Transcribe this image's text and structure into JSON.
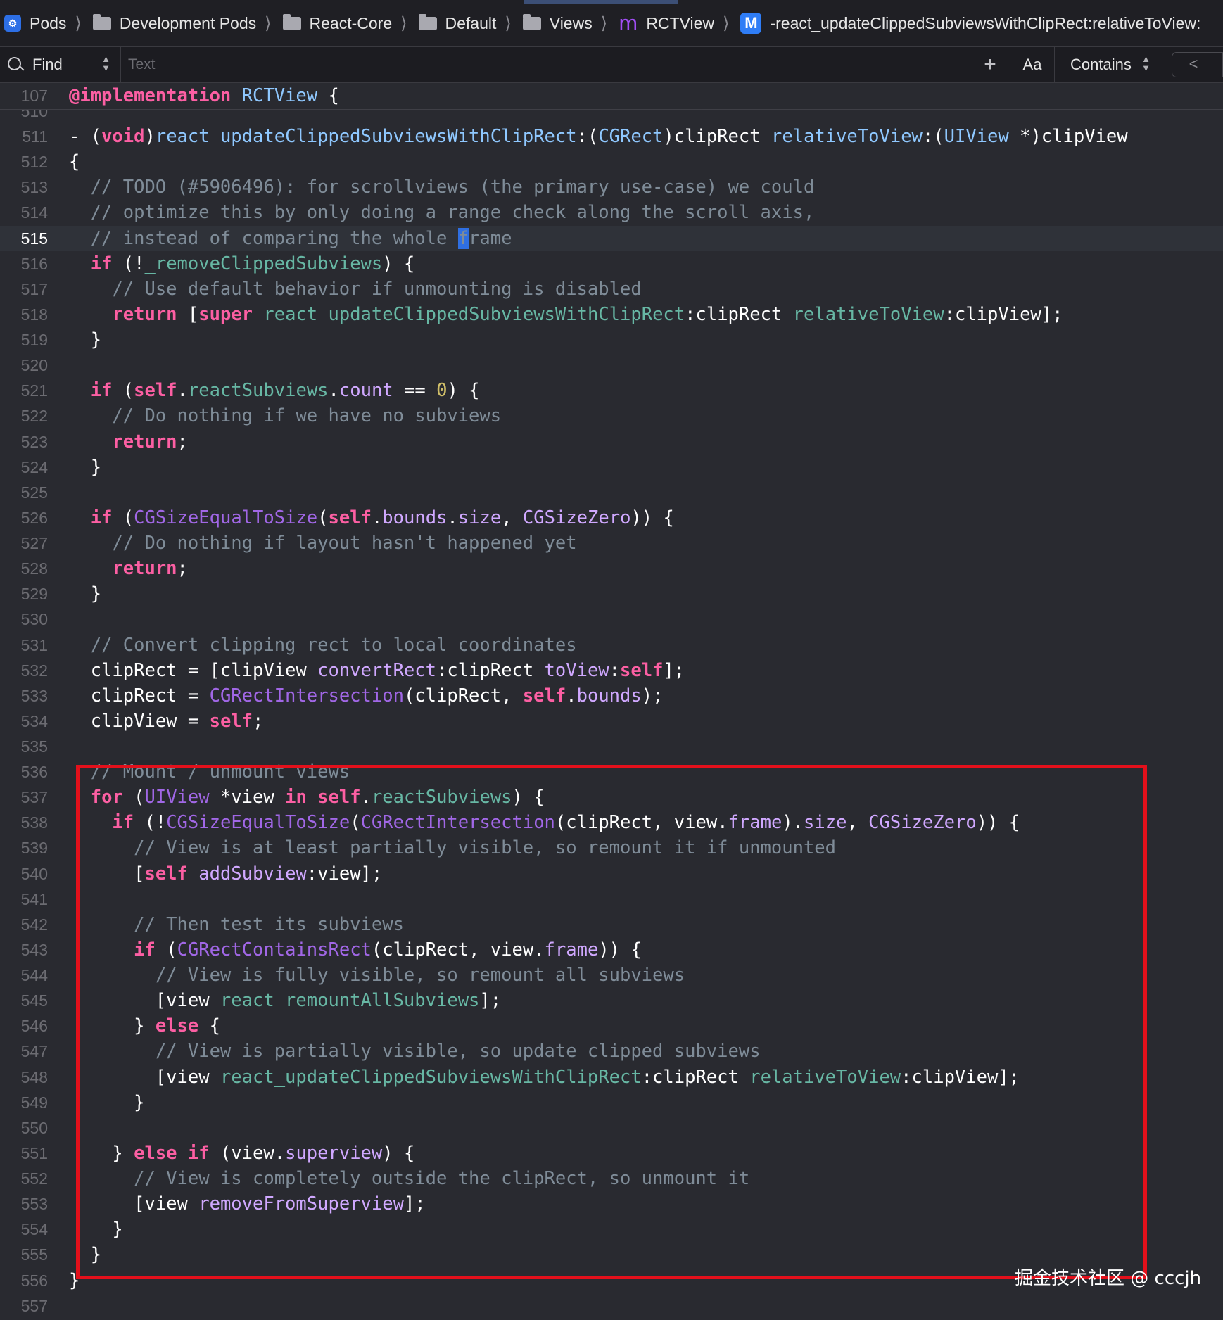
{
  "breadcrumb": {
    "items": [
      {
        "label": "Pods",
        "icon": "app-icon"
      },
      {
        "label": "Development Pods",
        "icon": "folder-icon"
      },
      {
        "label": "React-Core",
        "icon": "folder-icon"
      },
      {
        "label": "Default",
        "icon": "folder-icon"
      },
      {
        "label": "Views",
        "icon": "folder-icon"
      },
      {
        "label": "RCTView",
        "icon": "implementation-icon"
      },
      {
        "label": "-react_updateClippedSubviewsWithClipRect:relativeToView:",
        "icon": "method-icon"
      }
    ],
    "implementation_glyph": "m",
    "method_glyph": "M"
  },
  "findbar": {
    "mode": "Find",
    "placeholder": "Text",
    "add_label": "+",
    "case_label": "Aa",
    "match_mode": "Contains",
    "prev_label": "<"
  },
  "editor": {
    "current_line": "515",
    "sticky_header": {
      "number": "107",
      "tokens": [
        {
          "t": "@implementation",
          "c": "kw"
        },
        {
          "t": " "
        },
        {
          "t": "RCTView",
          "c": "ty"
        },
        {
          "t": " {"
        }
      ]
    },
    "lines": [
      {
        "n": "510",
        "tokens": []
      },
      {
        "n": "511",
        "tokens": [
          {
            "t": "- ("
          },
          {
            "t": "void",
            "c": "kw"
          },
          {
            "t": ")"
          },
          {
            "t": "react_updateClippedSubviewsWithClipRect",
            "c": "ty"
          },
          {
            "t": ":("
          },
          {
            "t": "CGRect",
            "c": "ty"
          },
          {
            "t": ")clipRect "
          },
          {
            "t": "relativeToView",
            "c": "ty"
          },
          {
            "t": ":("
          },
          {
            "t": "UIView",
            "c": "ty"
          },
          {
            "t": " *)clipView"
          }
        ]
      },
      {
        "n": "512",
        "tokens": [
          {
            "t": "{"
          }
        ]
      },
      {
        "n": "513",
        "tokens": [
          {
            "t": "  // TODO (#5906496): for scrollviews (the primary use-case) we could",
            "c": "cm"
          }
        ]
      },
      {
        "n": "514",
        "tokens": [
          {
            "t": "  // optimize this by only doing a range check along the scroll axis,",
            "c": "cm"
          }
        ]
      },
      {
        "n": "515",
        "tokens": [
          {
            "t": "  // instead of comparing the whole ",
            "c": "cm"
          },
          {
            "t": "f",
            "c": "cursor"
          },
          {
            "t": "rame",
            "c": "cm"
          }
        ]
      },
      {
        "n": "516",
        "tokens": [
          {
            "t": "  "
          },
          {
            "t": "if",
            "c": "kw"
          },
          {
            "t": " (!"
          },
          {
            "t": "_removeClippedSubviews",
            "c": "fn"
          },
          {
            "t": ") {"
          }
        ]
      },
      {
        "n": "517",
        "tokens": [
          {
            "t": "    // Use default behavior if unmounting is disabled",
            "c": "cm"
          }
        ]
      },
      {
        "n": "518",
        "tokens": [
          {
            "t": "    "
          },
          {
            "t": "return",
            "c": "kw"
          },
          {
            "t": " ["
          },
          {
            "t": "super",
            "c": "kw"
          },
          {
            "t": " "
          },
          {
            "t": "react_updateClippedSubviewsWithClipRect",
            "c": "fn"
          },
          {
            "t": ":clipRect "
          },
          {
            "t": "relativeToView",
            "c": "fn"
          },
          {
            "t": ":clipView];"
          }
        ]
      },
      {
        "n": "519",
        "tokens": [
          {
            "t": "  }"
          }
        ]
      },
      {
        "n": "520",
        "tokens": []
      },
      {
        "n": "521",
        "tokens": [
          {
            "t": "  "
          },
          {
            "t": "if",
            "c": "kw"
          },
          {
            "t": " ("
          },
          {
            "t": "self",
            "c": "kw"
          },
          {
            "t": "."
          },
          {
            "t": "reactSubviews",
            "c": "fn"
          },
          {
            "t": "."
          },
          {
            "t": "count",
            "c": "fc"
          },
          {
            "t": " == "
          },
          {
            "t": "0",
            "c": "num"
          },
          {
            "t": ") {"
          }
        ]
      },
      {
        "n": "522",
        "tokens": [
          {
            "t": "    // Do nothing if we have no subviews",
            "c": "cm"
          }
        ]
      },
      {
        "n": "523",
        "tokens": [
          {
            "t": "    "
          },
          {
            "t": "return",
            "c": "kw"
          },
          {
            "t": ";"
          }
        ]
      },
      {
        "n": "524",
        "tokens": [
          {
            "t": "  }"
          }
        ]
      },
      {
        "n": "525",
        "tokens": []
      },
      {
        "n": "526",
        "tokens": [
          {
            "t": "  "
          },
          {
            "t": "if",
            "c": "kw"
          },
          {
            "t": " ("
          },
          {
            "t": "CGSizeEqualToSize",
            "c": "cc"
          },
          {
            "t": "("
          },
          {
            "t": "self",
            "c": "kw"
          },
          {
            "t": "."
          },
          {
            "t": "bounds",
            "c": "fc"
          },
          {
            "t": "."
          },
          {
            "t": "size",
            "c": "fc"
          },
          {
            "t": ", "
          },
          {
            "t": "CGSizeZero",
            "c": "fc"
          },
          {
            "t": ")) {"
          }
        ]
      },
      {
        "n": "527",
        "tokens": [
          {
            "t": "    // Do nothing if layout hasn't happened yet",
            "c": "cm"
          }
        ]
      },
      {
        "n": "528",
        "tokens": [
          {
            "t": "    "
          },
          {
            "t": "return",
            "c": "kw"
          },
          {
            "t": ";"
          }
        ]
      },
      {
        "n": "529",
        "tokens": [
          {
            "t": "  }"
          }
        ]
      },
      {
        "n": "530",
        "tokens": []
      },
      {
        "n": "531",
        "tokens": [
          {
            "t": "  // Convert clipping rect to local coordinates",
            "c": "cm"
          }
        ]
      },
      {
        "n": "532",
        "tokens": [
          {
            "t": "  clipRect = [clipView "
          },
          {
            "t": "convertRect",
            "c": "fc"
          },
          {
            "t": ":clipRect "
          },
          {
            "t": "toView",
            "c": "fc"
          },
          {
            "t": ":"
          },
          {
            "t": "self",
            "c": "kw"
          },
          {
            "t": "];"
          }
        ]
      },
      {
        "n": "533",
        "tokens": [
          {
            "t": "  clipRect = "
          },
          {
            "t": "CGRectIntersection",
            "c": "cc"
          },
          {
            "t": "(clipRect, "
          },
          {
            "t": "self",
            "c": "kw"
          },
          {
            "t": "."
          },
          {
            "t": "bounds",
            "c": "fc"
          },
          {
            "t": ");"
          }
        ]
      },
      {
        "n": "534",
        "tokens": [
          {
            "t": "  clipView = "
          },
          {
            "t": "self",
            "c": "kw"
          },
          {
            "t": ";"
          }
        ]
      },
      {
        "n": "535",
        "tokens": []
      },
      {
        "n": "536",
        "tokens": [
          {
            "t": "  // Mount / unmount views",
            "c": "cm"
          }
        ]
      },
      {
        "n": "537",
        "tokens": [
          {
            "t": "  "
          },
          {
            "t": "for",
            "c": "kw"
          },
          {
            "t": " ("
          },
          {
            "t": "UIView",
            "c": "cc"
          },
          {
            "t": " *view "
          },
          {
            "t": "in",
            "c": "kw"
          },
          {
            "t": " "
          },
          {
            "t": "self",
            "c": "kw"
          },
          {
            "t": "."
          },
          {
            "t": "reactSubviews",
            "c": "fn"
          },
          {
            "t": ") {"
          }
        ]
      },
      {
        "n": "538",
        "tokens": [
          {
            "t": "    "
          },
          {
            "t": "if",
            "c": "kw"
          },
          {
            "t": " (!"
          },
          {
            "t": "CGSizeEqualToSize",
            "c": "cc"
          },
          {
            "t": "("
          },
          {
            "t": "CGRectIntersection",
            "c": "cc"
          },
          {
            "t": "(clipRect, view."
          },
          {
            "t": "frame",
            "c": "fc"
          },
          {
            "t": ")."
          },
          {
            "t": "size",
            "c": "fc"
          },
          {
            "t": ", "
          },
          {
            "t": "CGSizeZero",
            "c": "fc"
          },
          {
            "t": ")) {"
          }
        ]
      },
      {
        "n": "539",
        "tokens": [
          {
            "t": "      // View is at least partially visible, so remount it if unmounted",
            "c": "cm"
          }
        ]
      },
      {
        "n": "540",
        "tokens": [
          {
            "t": "      ["
          },
          {
            "t": "self",
            "c": "kw"
          },
          {
            "t": " "
          },
          {
            "t": "addSubview",
            "c": "fc"
          },
          {
            "t": ":view];"
          }
        ]
      },
      {
        "n": "541",
        "tokens": []
      },
      {
        "n": "542",
        "tokens": [
          {
            "t": "      // Then test its subviews",
            "c": "cm"
          }
        ]
      },
      {
        "n": "543",
        "tokens": [
          {
            "t": "      "
          },
          {
            "t": "if",
            "c": "kw"
          },
          {
            "t": " ("
          },
          {
            "t": "CGRectContainsRect",
            "c": "cc"
          },
          {
            "t": "(clipRect, view."
          },
          {
            "t": "frame",
            "c": "fc"
          },
          {
            "t": ")) {"
          }
        ]
      },
      {
        "n": "544",
        "tokens": [
          {
            "t": "        // View is fully visible, so remount all subviews",
            "c": "cm"
          }
        ]
      },
      {
        "n": "545",
        "tokens": [
          {
            "t": "        [view "
          },
          {
            "t": "react_remountAllSubviews",
            "c": "fn"
          },
          {
            "t": "];"
          }
        ]
      },
      {
        "n": "546",
        "tokens": [
          {
            "t": "      } "
          },
          {
            "t": "else",
            "c": "kw"
          },
          {
            "t": " {"
          }
        ]
      },
      {
        "n": "547",
        "tokens": [
          {
            "t": "        // View is partially visible, so update clipped subviews",
            "c": "cm"
          }
        ]
      },
      {
        "n": "548",
        "tokens": [
          {
            "t": "        [view "
          },
          {
            "t": "react_updateClippedSubviewsWithClipRect",
            "c": "fn"
          },
          {
            "t": ":clipRect "
          },
          {
            "t": "relativeToView",
            "c": "fn"
          },
          {
            "t": ":clipView];"
          }
        ]
      },
      {
        "n": "549",
        "tokens": [
          {
            "t": "      }"
          }
        ]
      },
      {
        "n": "550",
        "tokens": []
      },
      {
        "n": "551",
        "tokens": [
          {
            "t": "    } "
          },
          {
            "t": "else",
            "c": "kw"
          },
          {
            "t": " "
          },
          {
            "t": "if",
            "c": "kw"
          },
          {
            "t": " (view."
          },
          {
            "t": "superview",
            "c": "fc"
          },
          {
            "t": ") {"
          }
        ]
      },
      {
        "n": "552",
        "tokens": [
          {
            "t": "      // View is completely outside the clipRect, so unmount it",
            "c": "cm"
          }
        ]
      },
      {
        "n": "553",
        "tokens": [
          {
            "t": "      [view "
          },
          {
            "t": "removeFromSuperview",
            "c": "fc"
          },
          {
            "t": "];"
          }
        ]
      },
      {
        "n": "554",
        "tokens": [
          {
            "t": "    }"
          }
        ]
      },
      {
        "n": "555",
        "tokens": [
          {
            "t": "  }"
          }
        ]
      },
      {
        "n": "556",
        "tokens": [
          {
            "t": "}"
          }
        ]
      },
      {
        "n": "557",
        "tokens": []
      }
    ]
  },
  "annotation": {
    "color": "#e3101b",
    "start_line": "536",
    "end_line": "555"
  },
  "watermark": "掘金技术社区 @ cccjh"
}
